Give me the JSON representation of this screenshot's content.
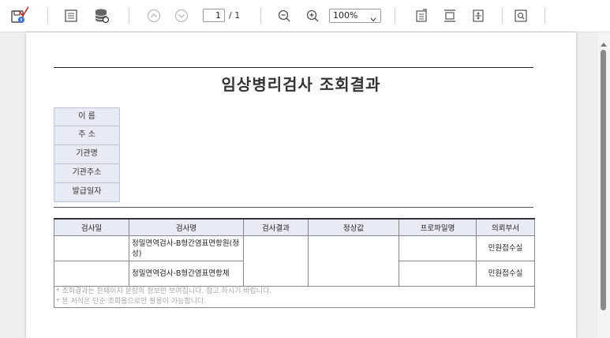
{
  "toolbar": {
    "page_current": "1",
    "page_total": "/ 1",
    "zoom": "100%"
  },
  "document": {
    "title": "임상병리검사 조회결과",
    "info_labels": [
      "이  름",
      "주  소",
      "기관명",
      "기관주소",
      "발급일자"
    ],
    "table": {
      "headers": [
        "검사일",
        "검사명",
        "검사결과",
        "정상값",
        "프로파일명",
        "의뢰부서"
      ],
      "rows": [
        {
          "date": "",
          "name": "정밀면역검사-B형간염표면항원(정성)",
          "result": "",
          "normal": "",
          "profile": "",
          "dept": "민원접수실"
        },
        {
          "date": "",
          "name": "정밀면역검사-B형간염표면항체",
          "result": "",
          "normal": "",
          "profile": "",
          "dept": "민원접수실"
        }
      ],
      "notes": [
        "* 조회결과는 한페이지 분량의 정보만 보여집니다. 참고 하시기 바랍니다.",
        "* 본 서식은 단순 조회용으로만 활용이 가능합니다."
      ]
    }
  },
  "colors": {
    "label_bg": "#e8eaf4",
    "check_mark": "#e02020"
  },
  "icons": [
    "save-icon",
    "page-view-icon",
    "database-icon",
    "prev-page-icon",
    "next-page-icon",
    "zoom-out-icon",
    "zoom-in-icon",
    "export-icon",
    "fit-width-icon",
    "fit-page-icon",
    "find-icon"
  ]
}
